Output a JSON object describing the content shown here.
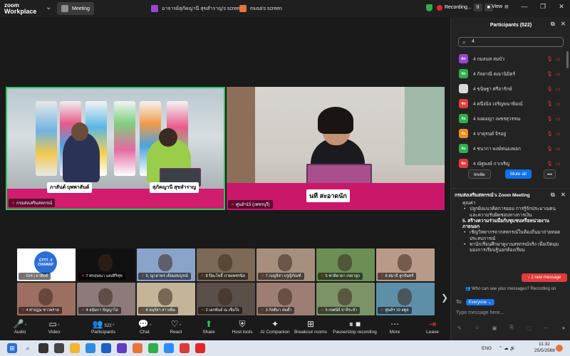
{
  "app": {
    "logo_line1": "zoom",
    "logo_line2": "Workplace"
  },
  "tabs": [
    {
      "label": "Meeting",
      "icon": "home-icon",
      "color": "#8f8f8f"
    },
    {
      "label": "อาจารย์สุภัคญานี สุขสำราญ's screen",
      "icon": "screen-share-icon",
      "color": "#9b45d6"
    },
    {
      "label": "musa's screen",
      "icon": "screen-share-icon",
      "color": "#e8743b"
    }
  ],
  "recording": {
    "label": "Recording...",
    "pause": "II",
    "stop": "■"
  },
  "view_label": "View",
  "videos": {
    "main1": {
      "label": "กรมส่งเสริมสหกรณ์",
      "nameplate_left": "ภาสันต์ บุพพาสันต์",
      "nameplate_right": "สุภัคญานี สุขสำราญ"
    },
    "main2": {
      "label": "ศูนย์ฯ15 (เพชรบุรี)",
      "nameplate": "นที สะอาดนัก"
    }
  },
  "gallery": [
    {
      "label": "014 | อาทิตย์",
      "bg": "#ffffff"
    },
    {
      "label": "7 ศกฤษณา แสงสิริสุข",
      "bg": "#111111"
    },
    {
      "label": "5. ญาดาพร เอี่ยมสมบูรณ์",
      "bg": "#8aa3c9"
    },
    {
      "label": "8 ปิยะโพธิ์ ภาพเพชรนิล",
      "bg": "#7b6a58"
    },
    {
      "label": "7 เบญจิสา บรูญิกัณฑ์",
      "bg": "#a68f7e"
    },
    {
      "label": "5 ฟาลิดาดา เขยาลูก",
      "bg": "#6b8f55"
    },
    {
      "label": "8 สมาธิ ลูกจันทร์",
      "bg": "#b89a88"
    },
    {
      "label": "4 ศาปฏม ชาวพราย",
      "bg": "#9d6f63"
    },
    {
      "label": "4 อนัมกา ปัญญาไส",
      "bg": "#8c7b7a"
    },
    {
      "label": "8 อนุรัสา สาวเพิ่ม",
      "bg": "#c4b49a"
    },
    {
      "label": "2 เอกพันธ์ ณ เข็มใจ",
      "bg": "#5a4f49"
    },
    {
      "label": "3 กัลติมา สมต้ำ",
      "bg": "#9d7e74"
    },
    {
      "label": "5 เขตนีย์ ปาลิระจำ",
      "bg": "#7c9368"
    },
    {
      "label": "ศูนย์ฯ 19 สตูล",
      "bg": "#5d8fa8"
    }
  ],
  "gallery_logo": {
    "line1": "CTTT_4",
    "line2": "CHAMAP"
  },
  "toolbar": [
    {
      "label": "Audio",
      "icon": "microphone-muted-icon"
    },
    {
      "label": "Video",
      "icon": "video-off-icon"
    },
    {
      "label": "Participants",
      "icon": "participants-icon",
      "badge": "522"
    },
    {
      "label": "Chat",
      "icon": "chat-icon"
    },
    {
      "label": "React",
      "icon": "heart-icon"
    },
    {
      "label": "Share",
      "icon": "share-arrow-icon"
    },
    {
      "label": "Host tools",
      "icon": "shield-icon"
    },
    {
      "label": "AI Companion",
      "icon": "sparkle-icon"
    },
    {
      "label": "Breakout rooms",
      "icon": "breakout-rooms-icon"
    },
    {
      "label": "Pause/stop recording",
      "icon": "pause-record-icon"
    },
    {
      "label": "More",
      "icon": "more-icon"
    },
    {
      "label": "Leave",
      "icon": "leave-icon"
    }
  ],
  "participants_panel": {
    "title": "Participants (522)",
    "search_value": "4",
    "items": [
      {
        "initials": "4n",
        "name": "4 กมลนท สมบัว",
        "color": "#9b45d6"
      },
      {
        "initials": "4n",
        "name": "4 กัลยาณี คณานิมิตร์",
        "color": "#2fae4b"
      },
      {
        "initials": "",
        "name": "4 ขนิษฐา ศรีอารักษ์",
        "color": "#d9d9d9"
      },
      {
        "initials": "4n",
        "name": "4 คนึงนิจ เจริญพนาพิมณ์",
        "color": "#e23b3b"
      },
      {
        "initials": "4s",
        "name": "4 จงดอญา เพชรสุวรรณ",
        "color": "#2fae4b"
      },
      {
        "initials": "4s",
        "name": "4 จาตุรนต์ จิรอยู่",
        "color": "#f08c1e"
      },
      {
        "initials": "4u",
        "name": "4 ชนากา พงษ์ทนองพอก",
        "color": "#2fae4b"
      },
      {
        "initials": "4n",
        "name": "4 ณัฐพงษ์ กาเจริญ",
        "color": "#e23b3b"
      }
    ],
    "invite_label": "Invite",
    "mute_all_label": "Mute all",
    "more_label": "•••"
  },
  "chat": {
    "title": "กรมส่งเสริมสหกรณ์'s Zoom Meeting",
    "lines_top": [
      "คุณค่า"
    ],
    "bullets1": [
      "ปลูกฝังแนวคิดการออม การรู้จักประมาณตน และความรับผิดชอบทางการเงิน"
    ],
    "heading": "5. สร้างความร่วมมือกับชุมชนหรือหน่วยงานภายนอก",
    "bullets2": [
      "เชิญวิทยากรจากสหกรณ์ในท้องถิ่นมาถ่ายทอดประสบการณ์",
      "พานักเรียนศึกษาดูงานสหกรณ์จริง เพื่อเปิดมุมมองการเรียนรู้นอกห้องเรียน"
    ],
    "new_message": "1 new message",
    "who_can_see": "Who can see your messages? Recording on",
    "to_label": "To:",
    "to_value": "Everyone",
    "placeholder": "Type message here..."
  },
  "taskbar": {
    "lang": "ENG",
    "time": "11:32",
    "date": "25/5/2568"
  }
}
